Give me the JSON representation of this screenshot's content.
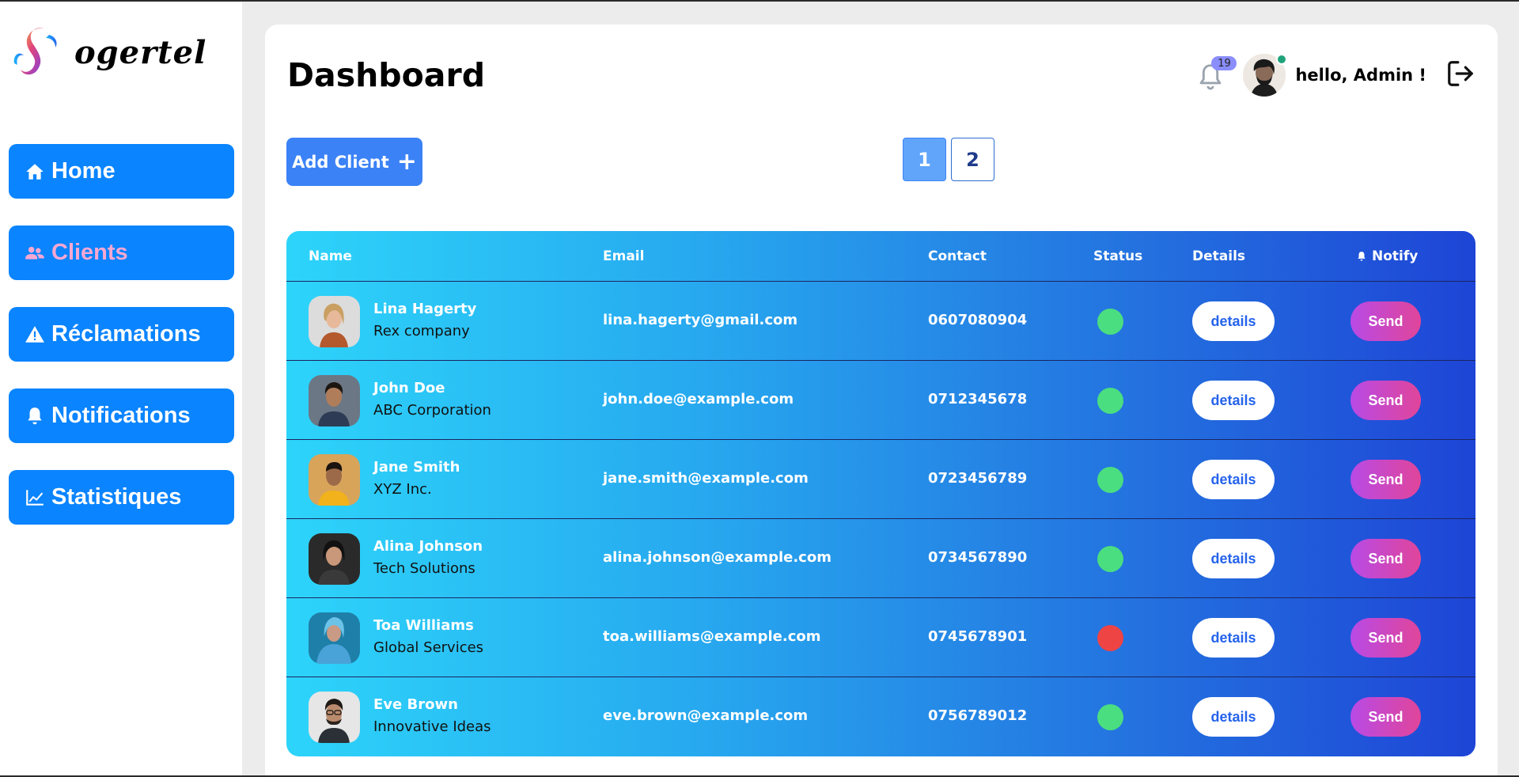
{
  "brand": {
    "name": "ogertel"
  },
  "sidebar": {
    "items": [
      {
        "label": "Home",
        "icon": "home-icon",
        "active": false
      },
      {
        "label": "Clients",
        "icon": "users-icon",
        "active": true
      },
      {
        "label": "Réclamations",
        "icon": "warning-icon",
        "active": false
      },
      {
        "label": "Notifications",
        "icon": "bell-icon",
        "active": false
      },
      {
        "label": "Statistiques",
        "icon": "chart-line-icon",
        "active": false
      }
    ]
  },
  "header": {
    "title": "Dashboard",
    "notification_count": "19",
    "greeting": "hello, Admin !"
  },
  "toolbar": {
    "add_client_label": "Add Client",
    "pages": [
      "1",
      "2"
    ],
    "current_page": "1"
  },
  "table": {
    "columns": {
      "name": "Name",
      "email": "Email",
      "contact": "Contact",
      "status": "Status",
      "details": "Details",
      "notify": "Notify"
    },
    "details_label": "details",
    "send_label": "Send",
    "rows": [
      {
        "name": "Lina Hagerty",
        "company": "Rex company",
        "email": "lina.hagerty@gmail.com",
        "contact": "0607080904",
        "status": "active"
      },
      {
        "name": "John Doe",
        "company": "ABC Corporation",
        "email": "john.doe@example.com",
        "contact": "0712345678",
        "status": "active"
      },
      {
        "name": "Jane Smith",
        "company": "XYZ Inc.",
        "email": "jane.smith@example.com",
        "contact": "0723456789",
        "status": "active"
      },
      {
        "name": "Alina Johnson",
        "company": "Tech Solutions",
        "email": "alina.johnson@example.com",
        "contact": "0734567890",
        "status": "active"
      },
      {
        "name": "Toa Williams",
        "company": "Global Services",
        "email": "toa.williams@example.com",
        "contact": "0745678901",
        "status": "inactive"
      },
      {
        "name": "Eve Brown",
        "company": "Innovative Ideas",
        "email": "eve.brown@example.com",
        "contact": "0756789012",
        "status": "active"
      }
    ]
  },
  "colors": {
    "nav": "#0a84ff",
    "nav_active_text": "#f7a8d2",
    "status_active": "#4ade80",
    "status_inactive": "#ef4444",
    "add_button": "#3b82f6"
  }
}
